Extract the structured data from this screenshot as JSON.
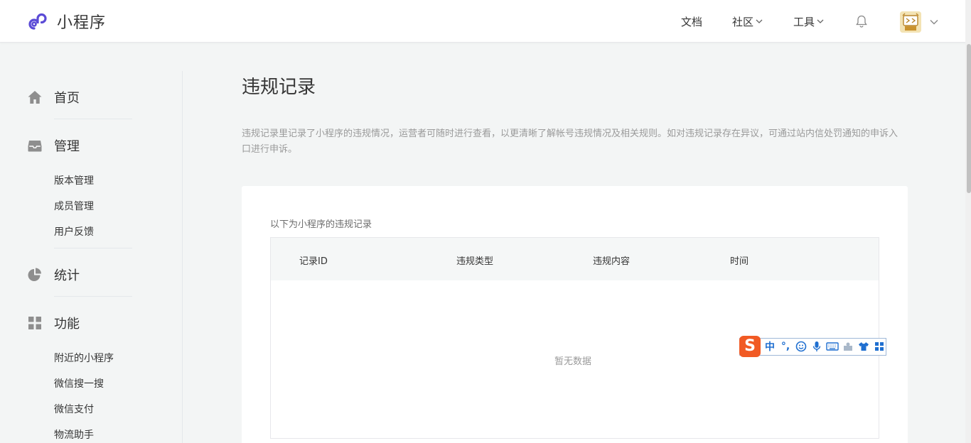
{
  "header": {
    "logo_text": "小程序",
    "nav": {
      "docs": "文档",
      "community": "社区",
      "tools": "工具"
    }
  },
  "sidebar": {
    "home": "首页",
    "manage": "管理",
    "manage_items": [
      "版本管理",
      "成员管理",
      "用户反馈"
    ],
    "stats": "统计",
    "features": "功能",
    "feature_items": [
      "附近的小程序",
      "微信搜一搜",
      "微信支付",
      "物流助手"
    ]
  },
  "main": {
    "title": "违规记录",
    "description": "违规记录里记录了小程序的违规情况，运营者可随时进行查看，以更清晰了解帐号违规情况及相关规则。如对违规记录存在异议，可通过站内信处罚通知的申诉入口进行申诉。",
    "card_title": "以下为小程序的违规记录",
    "table": {
      "columns": [
        "记录ID",
        "违规类型",
        "违规内容",
        "时间"
      ],
      "empty_text": "暂无数据"
    }
  },
  "ime": {
    "logo": "S",
    "mode": "中",
    "punct": "°,"
  },
  "colors": {
    "accent": "#4d6bfe",
    "logo_purple": "#5b4bd6",
    "ime_orange": "#f15a24",
    "ime_blue": "#1f6fd0"
  }
}
